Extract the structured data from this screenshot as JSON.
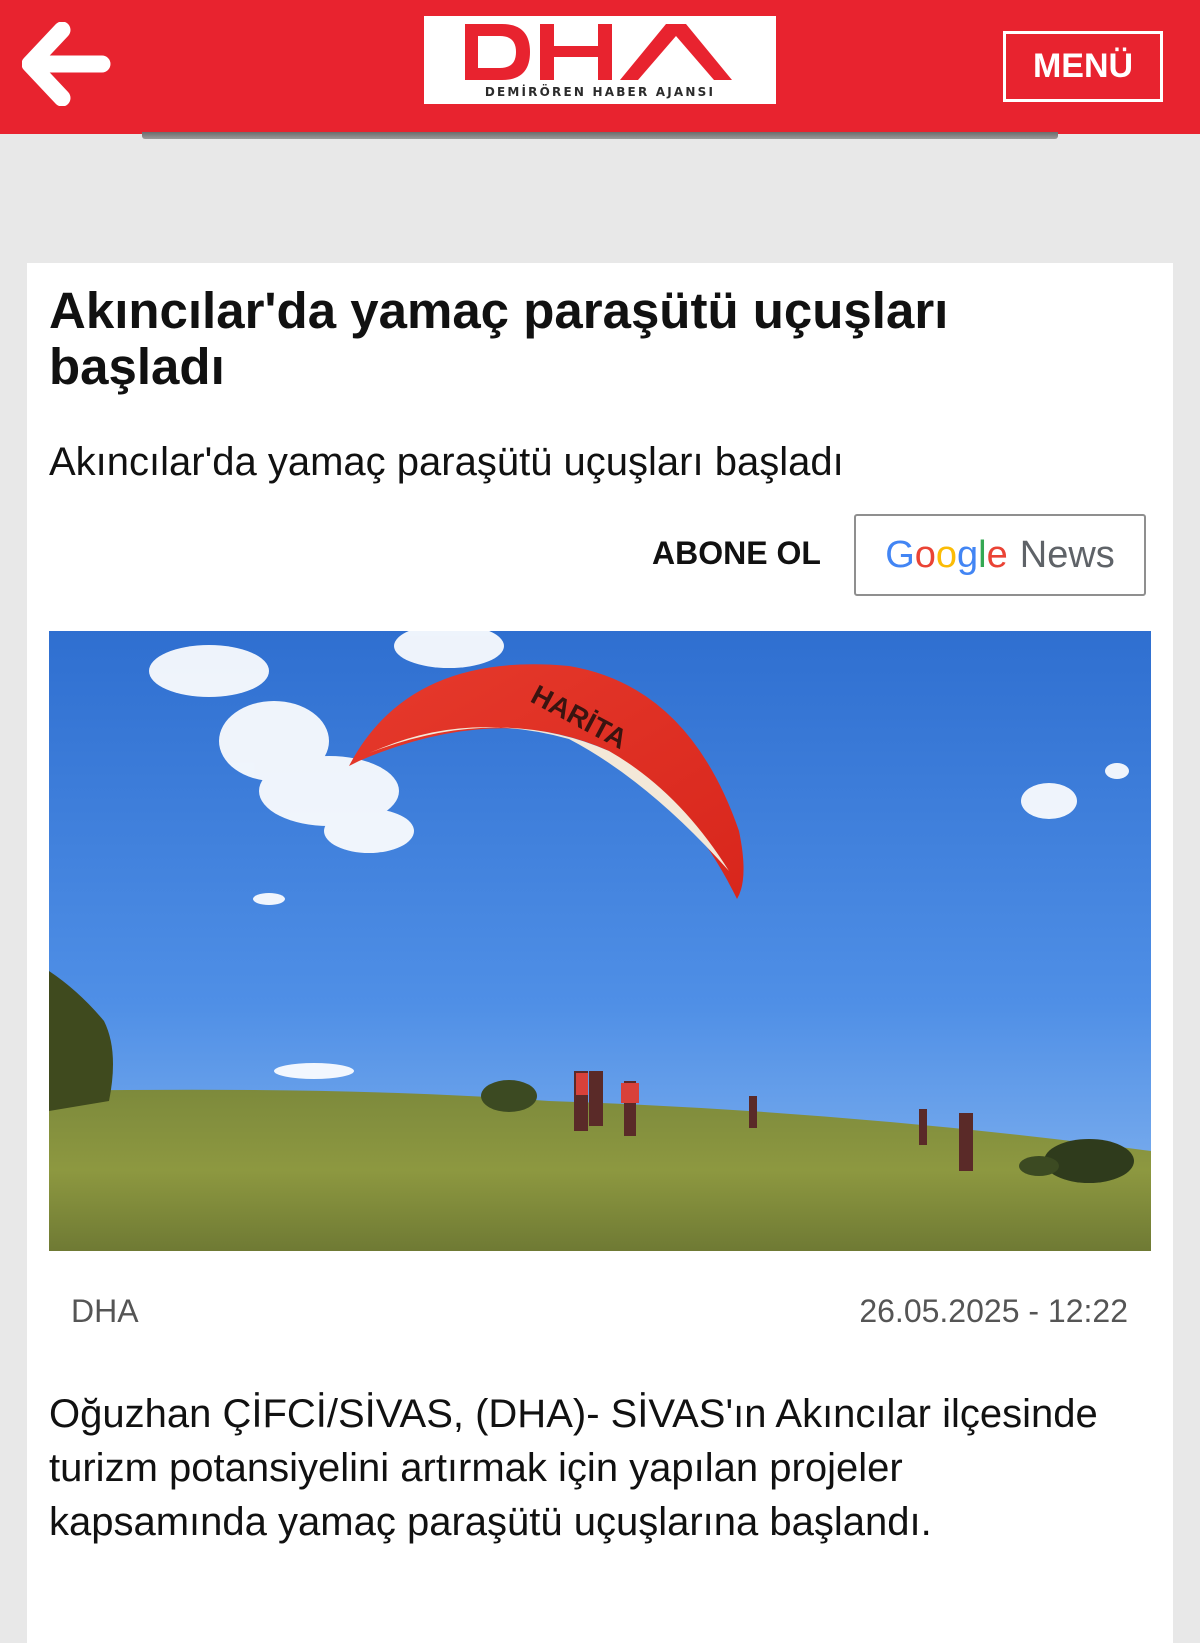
{
  "header": {
    "logo_text": "DHA",
    "logo_subtitle": "DEMİRÖREN HABER AJANSI",
    "menu_label": "MENÜ",
    "back_icon": "arrow-left-icon"
  },
  "article": {
    "headline": "Akıncılar'da yamaç paraşütü uçuşları başladı",
    "subtitle": "Akıncılar'da yamaç paraşütü uçuşları başladı",
    "subscribe_label": "ABONE OL",
    "google_news": {
      "google": "Google",
      "news": "News"
    },
    "image_canopy_text": "HARİTA",
    "source": "DHA",
    "datetime": "26.05.2025 - 12:22",
    "body": "Oğuzhan ÇİFCİ/SİVAS, (DHA)- SİVAS'ın Akıncılar ilçesinde turizm potansiyelini artırmak için yapılan projeler kapsamında yamaç paraşütü uçuşlarına başlandı."
  },
  "colors": {
    "brand_red": "#e8232f",
    "page_bg": "#e8e8e8",
    "card_bg": "#ffffff",
    "text": "#111111",
    "muted": "#555555"
  }
}
